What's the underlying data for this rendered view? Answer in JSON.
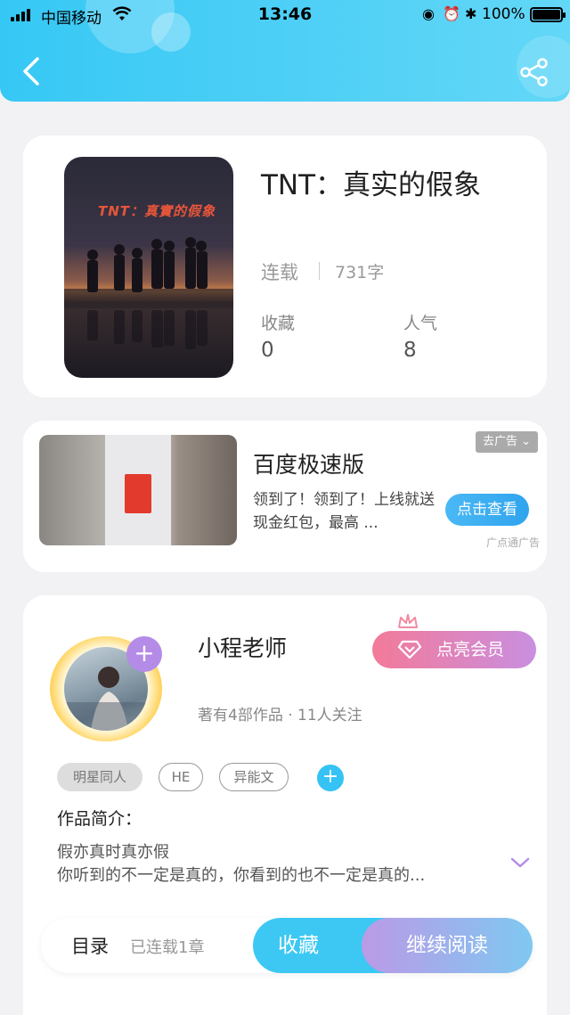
{
  "status_bar": {
    "carrier": "中国移动",
    "time": "13:46",
    "battery": "100%"
  },
  "header": {
    "back_icon": "chevron-left-icon",
    "share_icon": "share-icon",
    "gradient_start": "#36c8f5",
    "gradient_end": "#63d7f7"
  },
  "book": {
    "cover_title": "TNT：真實的假象",
    "title": "TNT：真实的假象",
    "status": "连载",
    "word_count": "731字",
    "favorites_label": "收藏",
    "favorites_value": "0",
    "popularity_label": "人气",
    "popularity_value": "8"
  },
  "ad": {
    "tag": "去广告 ⌄",
    "title": "百度极速版",
    "text": "领到了！领到了！上线就送现金红包，最高 ...",
    "button": "点击查看",
    "source": "广点通广告"
  },
  "author": {
    "name": "小程老师",
    "stats": "著有4部作品 · 11人关注",
    "vip_button": "点亮会员",
    "follow_icon": "plus-icon",
    "tags": [
      "明星同人",
      "HE",
      "异能文"
    ],
    "intro_label": "作品简介：",
    "intro_lines": [
      "假亦真时真亦假",
      "你听到的不一定是真的，你看到的也不一定是真的..."
    ],
    "accent": "#b58be8"
  },
  "bottom_bar": {
    "toc": "目录",
    "toc_status": "已连载1章",
    "favorite": "收藏",
    "continue_reading": "继续阅读"
  }
}
